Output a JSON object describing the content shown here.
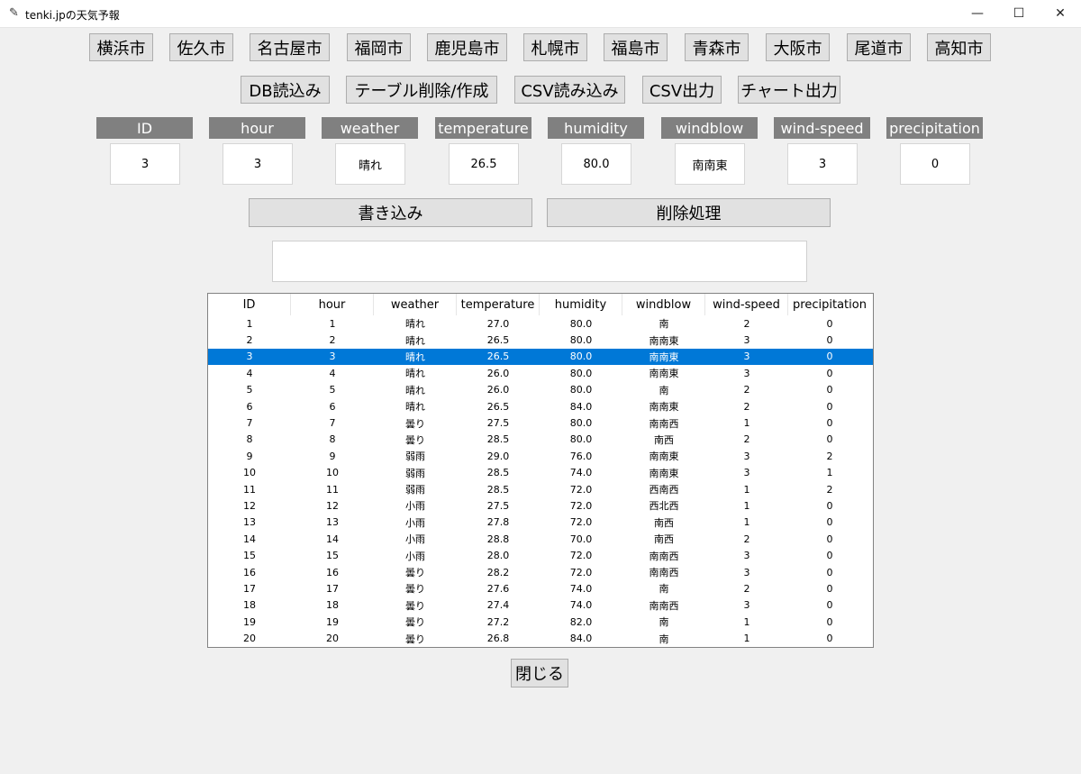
{
  "window": {
    "title": "tenki.jpの天気予報",
    "minimize": "—",
    "maximize": "☐",
    "close": "✕"
  },
  "cities": [
    "横浜市",
    "佐久市",
    "名古屋市",
    "福岡市",
    "鹿児島市",
    "札幌市",
    "福島市",
    "青森市",
    "大阪市",
    "尾道市",
    "高知市"
  ],
  "actions": [
    "DB読込み",
    "テーブル削除/作成",
    "CSV読み込み",
    "CSV出力",
    "チャート出力"
  ],
  "form": {
    "fields": [
      {
        "label": "ID",
        "value": "3"
      },
      {
        "label": "hour",
        "value": "3"
      },
      {
        "label": "weather",
        "value": "晴れ"
      },
      {
        "label": "temperature",
        "value": "26.5"
      },
      {
        "label": "humidity",
        "value": "80.0"
      },
      {
        "label": "windblow",
        "value": "南南東"
      },
      {
        "label": "wind-speed",
        "value": "3"
      },
      {
        "label": "precipitation",
        "value": "0"
      }
    ],
    "write_label": "書き込み",
    "delete_label": "削除処理",
    "message": ""
  },
  "table": {
    "columns": [
      "ID",
      "hour",
      "weather",
      "temperature",
      "humidity",
      "windblow",
      "wind-speed",
      "precipitation"
    ],
    "selected_index": 2,
    "rows": [
      [
        "1",
        "1",
        "晴れ",
        "27.0",
        "80.0",
        "南",
        "2",
        "0"
      ],
      [
        "2",
        "2",
        "晴れ",
        "26.5",
        "80.0",
        "南南東",
        "3",
        "0"
      ],
      [
        "3",
        "3",
        "晴れ",
        "26.5",
        "80.0",
        "南南東",
        "3",
        "0"
      ],
      [
        "4",
        "4",
        "晴れ",
        "26.0",
        "80.0",
        "南南東",
        "3",
        "0"
      ],
      [
        "5",
        "5",
        "晴れ",
        "26.0",
        "80.0",
        "南",
        "2",
        "0"
      ],
      [
        "6",
        "6",
        "晴れ",
        "26.5",
        "84.0",
        "南南東",
        "2",
        "0"
      ],
      [
        "7",
        "7",
        "曇り",
        "27.5",
        "80.0",
        "南南西",
        "1",
        "0"
      ],
      [
        "8",
        "8",
        "曇り",
        "28.5",
        "80.0",
        "南西",
        "2",
        "0"
      ],
      [
        "9",
        "9",
        "弱雨",
        "29.0",
        "76.0",
        "南南東",
        "3",
        "2"
      ],
      [
        "10",
        "10",
        "弱雨",
        "28.5",
        "74.0",
        "南南東",
        "3",
        "1"
      ],
      [
        "11",
        "11",
        "弱雨",
        "28.5",
        "72.0",
        "西南西",
        "1",
        "2"
      ],
      [
        "12",
        "12",
        "小雨",
        "27.5",
        "72.0",
        "西北西",
        "1",
        "0"
      ],
      [
        "13",
        "13",
        "小雨",
        "27.8",
        "72.0",
        "南西",
        "1",
        "0"
      ],
      [
        "14",
        "14",
        "小雨",
        "28.8",
        "70.0",
        "南西",
        "2",
        "0"
      ],
      [
        "15",
        "15",
        "小雨",
        "28.0",
        "72.0",
        "南南西",
        "3",
        "0"
      ],
      [
        "16",
        "16",
        "曇り",
        "28.2",
        "72.0",
        "南南西",
        "3",
        "0"
      ],
      [
        "17",
        "17",
        "曇り",
        "27.6",
        "74.0",
        "南",
        "2",
        "0"
      ],
      [
        "18",
        "18",
        "曇り",
        "27.4",
        "74.0",
        "南南西",
        "3",
        "0"
      ],
      [
        "19",
        "19",
        "曇り",
        "27.2",
        "82.0",
        "南",
        "1",
        "0"
      ],
      [
        "20",
        "20",
        "曇り",
        "26.8",
        "84.0",
        "南",
        "1",
        "0"
      ]
    ]
  },
  "close_label": "閉じる"
}
